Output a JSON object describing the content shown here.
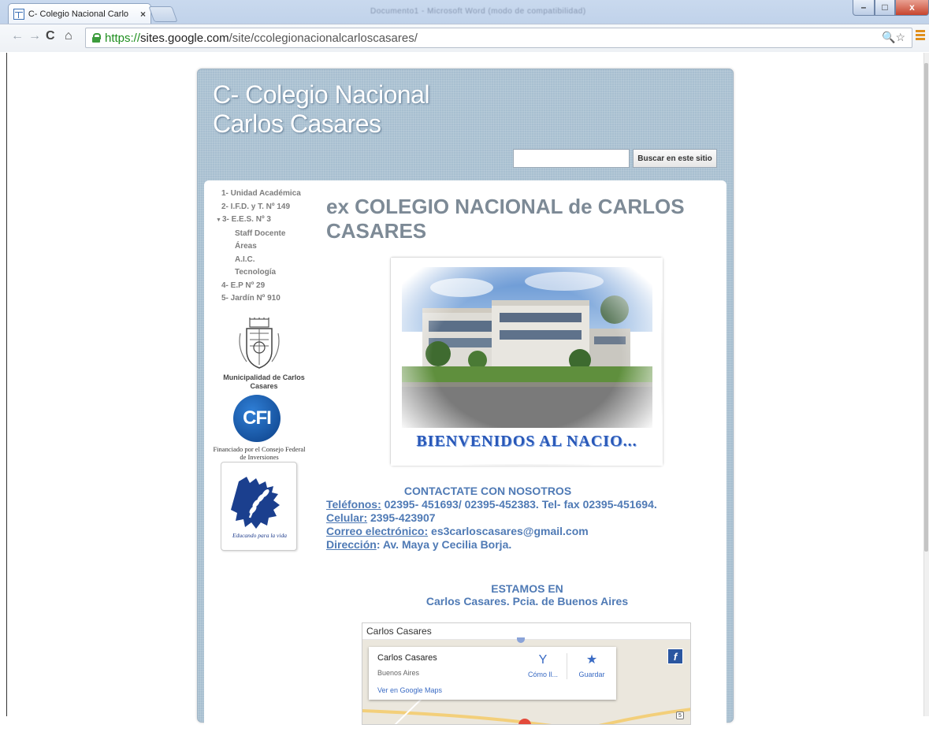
{
  "browser": {
    "tab_title": "C- Colegio Nacional Carlo",
    "tab_close": "×",
    "background_window_text": "Documento1 - Microsoft Word (modo de compatibilidad)",
    "url_scheme": "https://",
    "url_host": "sites.google.com",
    "url_path": "/site/ccolegionacionalcarloscasares/",
    "omni_icons": "🔍☆"
  },
  "site": {
    "title": "C- Colegio Nacional Carlos Casares",
    "search_placeholder": "",
    "search_button": "Buscar en este sitio"
  },
  "nav": {
    "items": [
      {
        "label": "1- Unidad Académica"
      },
      {
        "label": "2- I.F.D. y T. Nº 149"
      },
      {
        "label": "3- E.E.S. Nº 3",
        "expanded": true
      },
      {
        "label": "Staff Docente"
      },
      {
        "label": "Áreas"
      },
      {
        "label": "A.I.C."
      },
      {
        "label": "Tecnología"
      },
      {
        "label": "4- E.P Nº 29"
      },
      {
        "label": "5- Jardín Nº 910"
      }
    ]
  },
  "sidebar_logos": {
    "municipalidad_caption": "Municipalidad de Carlos Casares",
    "cfi_logo_text": "CFI",
    "cfi_caption": "Financiado por el Consejo Federal de Inversiones",
    "educando_caption": "Educando para la vida"
  },
  "main": {
    "heading": "ex COLEGIO NACIONAL de CARLOS CASARES",
    "photo_caption": "BIENVENIDOS AL NACIO...",
    "contact": {
      "title": "CONTACTATE CON NOSOTROS",
      "phones_label": "Teléfonos:",
      "phones_value": " 02395- 451693/ 02395-452383. Tel- fax 02395-451694.",
      "cell_label": "Celular:",
      "cell_value": " 2395-423907",
      "email_label": "Correo electrónico:",
      "email_value": " es3carloscasares@gmail.com",
      "address_label": "Dirección",
      "address_value": ": Av. Maya y Cecilia Borja."
    },
    "location": {
      "line1": "ESTAMOS EN",
      "line2": "Carlos Casares. Pcia. de Buenos Aires"
    }
  },
  "map": {
    "title": "Carlos Casares",
    "place_name": "Carlos Casares",
    "place_region": "Buenos Aires",
    "directions_label": "Cómo ll...",
    "save_label": "Guardar",
    "view_link": "Ver en Google Maps",
    "road_badge": "5"
  },
  "colors": {
    "site_accent": "#a8bfd0",
    "link_blue": "#4f7ab5",
    "heading_gray": "#7d8a96"
  }
}
